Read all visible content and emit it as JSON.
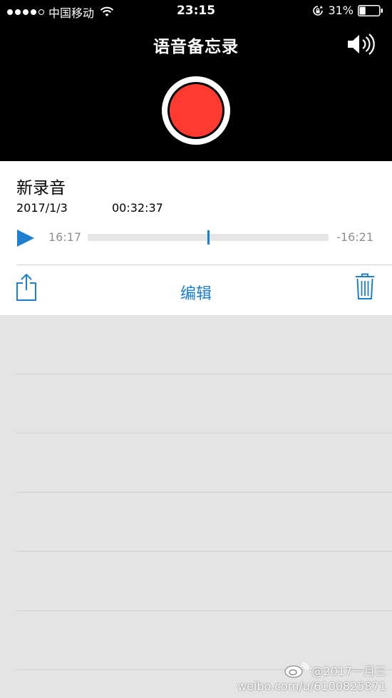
{
  "status_bar": {
    "carrier": "中国移动",
    "time": "23:15",
    "battery_percent": "31%",
    "signal_bars_filled": 4,
    "signal_bars_total": 5,
    "battery_level": 0.31
  },
  "header": {
    "title": "语音备忘录",
    "speaker_icon": "speaker-icon",
    "record_icon": "record-icon"
  },
  "memo": {
    "title": "新录音",
    "date": "2017/1/3",
    "duration": "00:32:37",
    "elapsed": "16:17",
    "remaining": "-16:21",
    "progress": 0.5,
    "play_icon": "play-icon"
  },
  "toolbar": {
    "share_icon": "share-icon",
    "edit_label": "编辑",
    "trash_icon": "trash-icon"
  },
  "watermark": {
    "handle": "@2017一月三",
    "url": "weibo.com/u/6100825871"
  },
  "colors": {
    "accent": "#1e7fd1",
    "record": "#ff3b30",
    "header_bg": "#000000",
    "list_bg": "#e4e4e4"
  }
}
